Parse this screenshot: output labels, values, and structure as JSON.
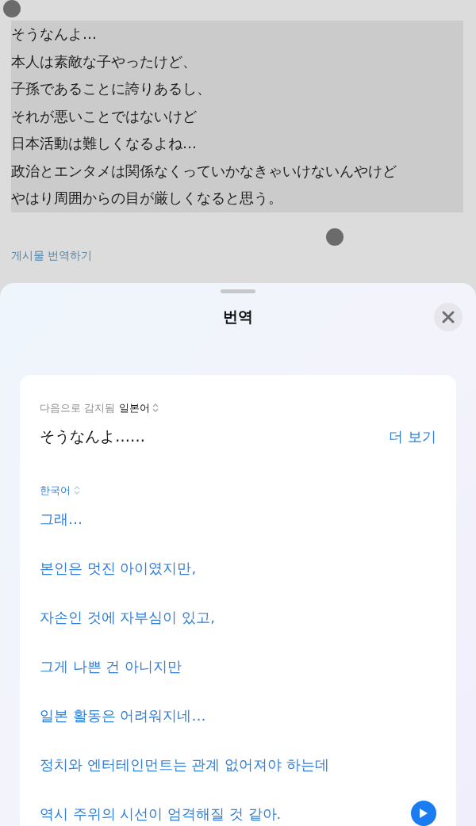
{
  "post": {
    "lines": [
      "そうなんよ…",
      "本人は素敵な子やったけど、",
      "子孫であることに誇りあるし、",
      "それが悪いことではないけど",
      "日本活動は難しくなるよね…",
      "政治とエンタメは関係なくっていかなきゃいけないんやけど",
      "やはり周囲からの目が厳しくなると思う。"
    ],
    "selected": true,
    "translate_link": "게시물 번역하기"
  },
  "sheet": {
    "title": "번역",
    "source": {
      "label": "다음으로 감지됨",
      "language": "일본어",
      "text": "そうなんよ……",
      "more": "더 보기"
    },
    "target": {
      "language": "한국어",
      "lines": [
        "그래…",
        "본인은 멋진 아이였지만,",
        "자손인 것에 자부심이 있고,",
        "그게 나쁜 건 아니지만",
        "일본 활동은 어려워지네…",
        "정치와 엔터테인먼트는 관계 없어져야 하는데",
        "역시 주위의 시선이 엄격해질 것 같아."
      ]
    }
  }
}
